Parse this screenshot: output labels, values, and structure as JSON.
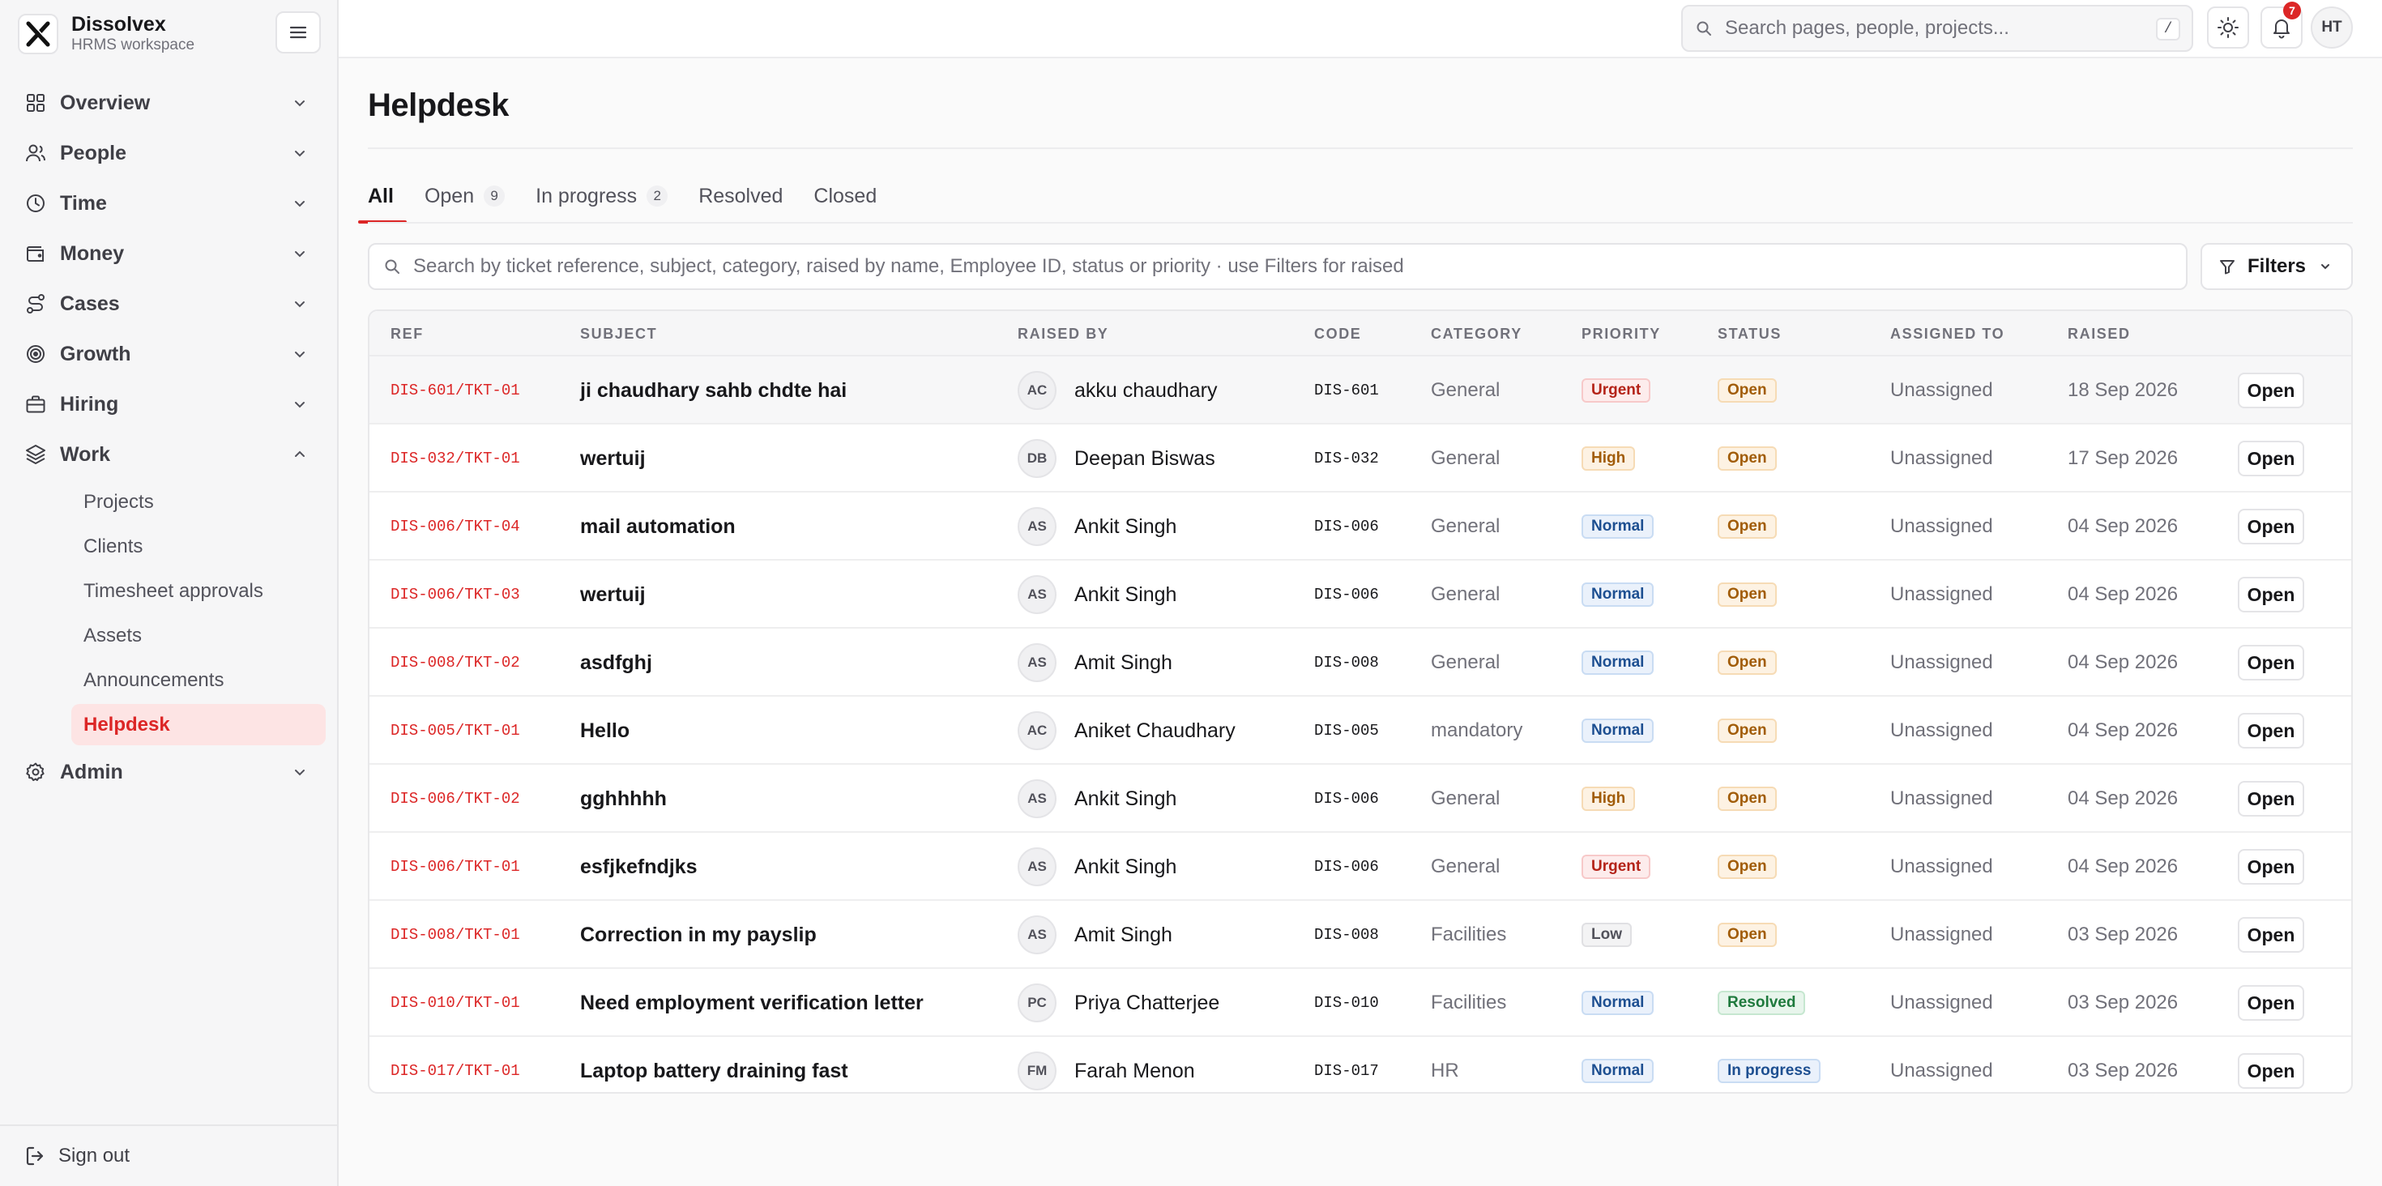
{
  "brand": {
    "name": "Dissolvex",
    "subtitle": "HRMS workspace"
  },
  "topbar": {
    "search_placeholder": "Search pages, people, projects...",
    "search_shortcut": "/",
    "notification_count": "7",
    "user_initials": "HT"
  },
  "sidebar": {
    "items": [
      {
        "label": "Overview",
        "icon": "grid-icon"
      },
      {
        "label": "People",
        "icon": "people-icon"
      },
      {
        "label": "Time",
        "icon": "clock-icon"
      },
      {
        "label": "Money",
        "icon": "wallet-icon"
      },
      {
        "label": "Cases",
        "icon": "route-icon"
      },
      {
        "label": "Growth",
        "icon": "target-icon"
      },
      {
        "label": "Hiring",
        "icon": "briefcase-icon"
      },
      {
        "label": "Work",
        "icon": "layers-icon"
      }
    ],
    "work_sub": [
      "Projects",
      "Clients",
      "Timesheet approvals",
      "Assets",
      "Announcements",
      "Helpdesk"
    ],
    "admin_label": "Admin",
    "signout_label": "Sign out"
  },
  "page": {
    "title": "Helpdesk"
  },
  "tabs": [
    {
      "label": "All",
      "count": ""
    },
    {
      "label": "Open",
      "count": "9"
    },
    {
      "label": "In progress",
      "count": "2"
    },
    {
      "label": "Resolved",
      "count": ""
    },
    {
      "label": "Closed",
      "count": ""
    }
  ],
  "table_search_placeholder": "Search by ticket reference, subject, category, raised by name, Employee ID, status or priority · use Filters for raised",
  "filters_label": "Filters",
  "columns": [
    "REF",
    "SUBJECT",
    "RAISED BY",
    "CODE",
    "CATEGORY",
    "PRIORITY",
    "STATUS",
    "ASSIGNED TO",
    "RAISED"
  ],
  "rows": [
    {
      "ref": "DIS-601/TKT-01",
      "subject": "ji chaudhary sahb chdte hai",
      "initials": "AC",
      "name": "akku chaudhary",
      "code": "DIS-601",
      "category": "General",
      "priority": "Urgent",
      "status": "Open",
      "assigned": "Unassigned",
      "raised": "18 Sep 2026",
      "action": "Open"
    },
    {
      "ref": "DIS-032/TKT-01",
      "subject": "wertuij",
      "initials": "DB",
      "name": "Deepan Biswas",
      "code": "DIS-032",
      "category": "General",
      "priority": "High",
      "status": "Open",
      "assigned": "Unassigned",
      "raised": "17 Sep 2026",
      "action": "Open"
    },
    {
      "ref": "DIS-006/TKT-04",
      "subject": "mail automation",
      "initials": "AS",
      "name": "Ankit Singh",
      "code": "DIS-006",
      "category": "General",
      "priority": "Normal",
      "status": "Open",
      "assigned": "Unassigned",
      "raised": "04 Sep 2026",
      "action": "Open"
    },
    {
      "ref": "DIS-006/TKT-03",
      "subject": "wertuij",
      "initials": "AS",
      "name": "Ankit Singh",
      "code": "DIS-006",
      "category": "General",
      "priority": "Normal",
      "status": "Open",
      "assigned": "Unassigned",
      "raised": "04 Sep 2026",
      "action": "Open"
    },
    {
      "ref": "DIS-008/TKT-02",
      "subject": "asdfghj",
      "initials": "AS",
      "name": "Amit Singh",
      "code": "DIS-008",
      "category": "General",
      "priority": "Normal",
      "status": "Open",
      "assigned": "Unassigned",
      "raised": "04 Sep 2026",
      "action": "Open"
    },
    {
      "ref": "DIS-005/TKT-01",
      "subject": "Hello",
      "initials": "AC",
      "name": "Aniket Chaudhary",
      "code": "DIS-005",
      "category": "mandatory",
      "priority": "Normal",
      "status": "Open",
      "assigned": "Unassigned",
      "raised": "04 Sep 2026",
      "action": "Open"
    },
    {
      "ref": "DIS-006/TKT-02",
      "subject": "gghhhhh",
      "initials": "AS",
      "name": "Ankit Singh",
      "code": "DIS-006",
      "category": "General",
      "priority": "High",
      "status": "Open",
      "assigned": "Unassigned",
      "raised": "04 Sep 2026",
      "action": "Open"
    },
    {
      "ref": "DIS-006/TKT-01",
      "subject": "esfjkefndjks",
      "initials": "AS",
      "name": "Ankit Singh",
      "code": "DIS-006",
      "category": "General",
      "priority": "Urgent",
      "status": "Open",
      "assigned": "Unassigned",
      "raised": "04 Sep 2026",
      "action": "Open"
    },
    {
      "ref": "DIS-008/TKT-01",
      "subject": "Correction in my payslip",
      "initials": "AS",
      "name": "Amit Singh",
      "code": "DIS-008",
      "category": "Facilities",
      "priority": "Low",
      "status": "Open",
      "assigned": "Unassigned",
      "raised": "03 Sep 2026",
      "action": "Open"
    },
    {
      "ref": "DIS-010/TKT-01",
      "subject": "Need employment verification letter",
      "initials": "PC",
      "name": "Priya Chatterjee",
      "code": "DIS-010",
      "category": "Facilities",
      "priority": "Normal",
      "status": "Resolved",
      "assigned": "Unassigned",
      "raised": "03 Sep 2026",
      "action": "Open"
    },
    {
      "ref": "DIS-017/TKT-01",
      "subject": "Laptop battery draining fast",
      "initials": "FM",
      "name": "Farah Menon",
      "code": "DIS-017",
      "category": "HR",
      "priority": "Normal",
      "status": "In progress",
      "assigned": "Unassigned",
      "raised": "03 Sep 2026",
      "action": "Open"
    }
  ],
  "colors": {
    "accent": "#dc2626",
    "active_bg": "#fde4e4"
  }
}
